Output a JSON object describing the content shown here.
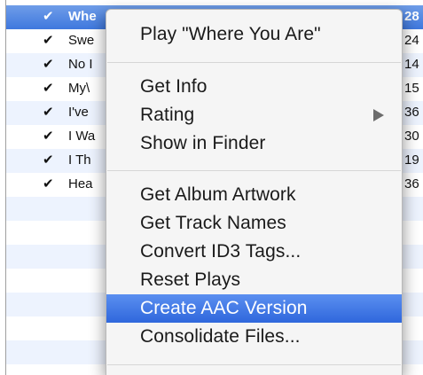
{
  "tracks": [
    {
      "check": "✔",
      "name": "Whe",
      "time": "28",
      "selected": true
    },
    {
      "check": "✔",
      "name": "Swe",
      "time": "24"
    },
    {
      "check": "✔",
      "name": "No I",
      "time": "14"
    },
    {
      "check": "✔",
      "name": "My\\",
      "time": "15"
    },
    {
      "check": "✔",
      "name": "I've",
      "time": "36"
    },
    {
      "check": "✔",
      "name": "I Wa",
      "time": "30"
    },
    {
      "check": "✔",
      "name": "I Th",
      "time": "19"
    },
    {
      "check": "✔",
      "name": "Hea",
      "time": "36"
    }
  ],
  "context_menu": {
    "play": "Play \"Where You Are\"",
    "get_info": "Get Info",
    "rating": "Rating",
    "show_in_finder": "Show in Finder",
    "get_album_artwork": "Get Album Artwork",
    "get_track_names": "Get Track Names",
    "convert_id3_tags": "Convert ID3 Tags...",
    "reset_plays": "Reset Plays",
    "create_aac_version": "Create AAC Version",
    "consolidate_files": "Consolidate Files..."
  },
  "icons": {
    "check": "checkmark-icon",
    "submenu": "submenu-arrow-icon"
  },
  "colors": {
    "selection": "#3f78de",
    "menu_highlight": "#2f67dc",
    "alt_row": "#edf3fe"
  }
}
